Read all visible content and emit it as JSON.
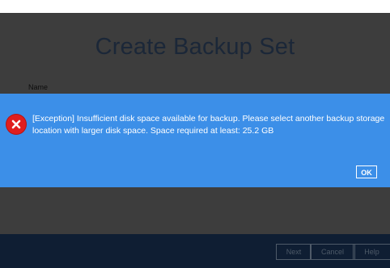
{
  "window": {
    "title": "Create Backup Set",
    "name_label": "Name"
  },
  "footer": {
    "next_label": "Next",
    "cancel_label": "Cancel",
    "help_label": "Help"
  },
  "dialog": {
    "icon": "error-icon",
    "message": "[Exception] Insufficient disk space available for backup. Please select another backup storage location with larger disk space. Space required at least: 25.2 GB",
    "ok_label": "OK"
  },
  "colors": {
    "dialog_background": "#3c8fe8",
    "overlay": "#3d3d3d",
    "footer": "#0f1e33",
    "error_red": "#e01e1e"
  }
}
